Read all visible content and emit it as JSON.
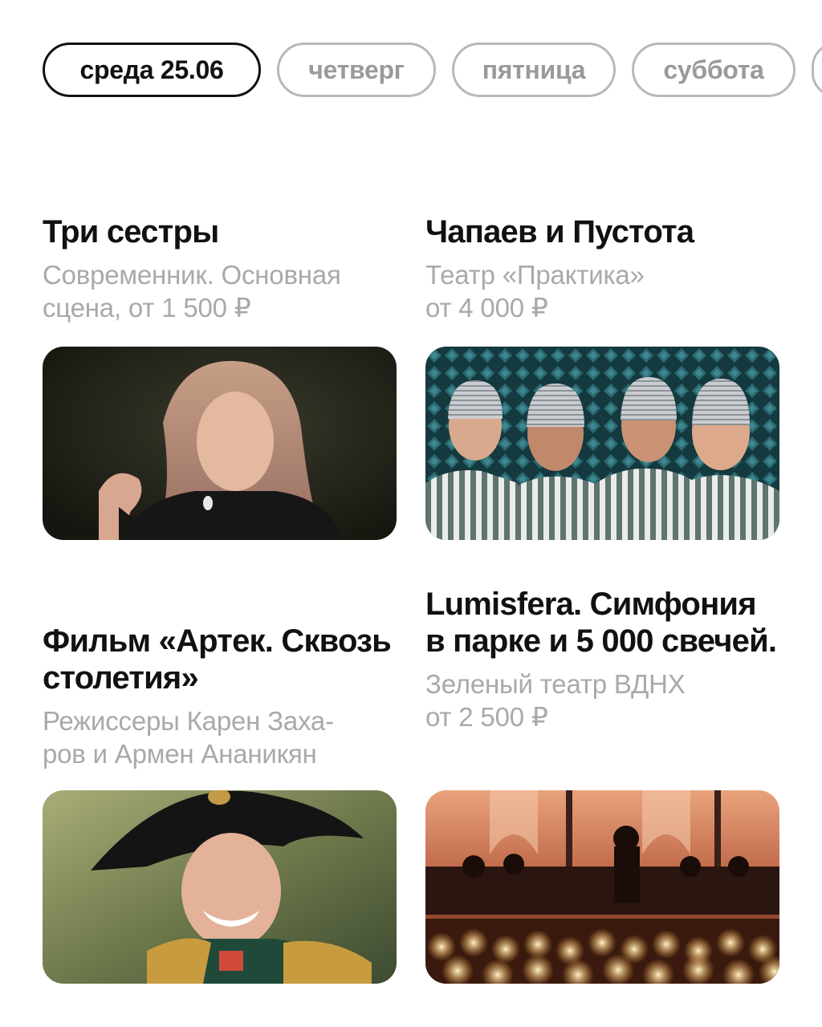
{
  "days": [
    {
      "label": "среда 25.06",
      "active": true
    },
    {
      "label": "четверг",
      "active": false
    },
    {
      "label": "пятница",
      "active": false
    },
    {
      "label": "суббота",
      "active": false
    },
    {
      "label": "",
      "active": false
    }
  ],
  "events": [
    {
      "title_lines": [
        "Три сестры"
      ],
      "venue_lines": [
        "Современник. Основная",
        "сцена, от 1 500 ₽"
      ]
    },
    {
      "title_lines": [
        "Чапаев и Пустота"
      ],
      "venue_lines": [
        "Театр «Практика»",
        "от 4 000 ₽"
      ]
    },
    {
      "title_lines": [
        "Фильм «Артек.",
        "Сквозь столетия»"
      ],
      "venue_lines": [
        "Режиссеры Карен Заха-",
        "ров и Армен Ананикян"
      ]
    },
    {
      "title_lines": [
        "Lumisfera.",
        "Симфония в парке",
        "и 5 000 свечей."
      ],
      "venue_lines": [
        "Зеленый театр ВДНХ",
        "от 2 500 ₽"
      ]
    }
  ]
}
